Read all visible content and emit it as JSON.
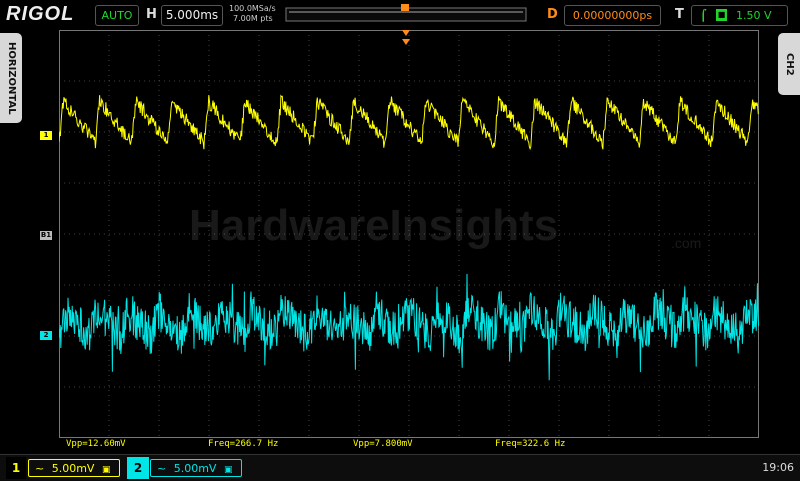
{
  "brand": {
    "logo": "RIGOL",
    "watermark": "HardwareInsights",
    "watermark_suffix": ".com"
  },
  "top": {
    "run_status": "AUTO",
    "horizontal_label": "H",
    "timebase": "5.000ms",
    "sample_rate": "100.0MSa/s",
    "memory_depth": "7.00M pts",
    "delay_label": "D",
    "delay_value": "0.00000000ps",
    "trigger_label": "T",
    "trigger_level": "1.50 V"
  },
  "side": {
    "left_tab": "HORIZONTAL",
    "right_tab": "CH2"
  },
  "markers": {
    "ch1": "1",
    "ch2": "2",
    "ref": "B1"
  },
  "measurements": [
    {
      "label": "Vpp=12.60mV",
      "color": "#ffff00"
    },
    {
      "label": "Freq=266.7 Hz",
      "color": "#ffff00"
    },
    {
      "label": "Vpp=7.800mV",
      "color": "#ffff00"
    },
    {
      "label": "Freq=322.6 Hz",
      "color": "#ffff00"
    }
  ],
  "channels": [
    {
      "num": "1",
      "scale": "5.00mV",
      "coupling": "~",
      "color": "#ffff00"
    },
    {
      "num": "2",
      "scale": "5.00mV",
      "coupling": "~",
      "color": "#00e5e5"
    }
  ],
  "clock": "19:06",
  "colors": {
    "ch1": "#ffff00",
    "ch2": "#00e5e5",
    "trigger": "#ff8c1a",
    "status": "#22d42a"
  }
}
